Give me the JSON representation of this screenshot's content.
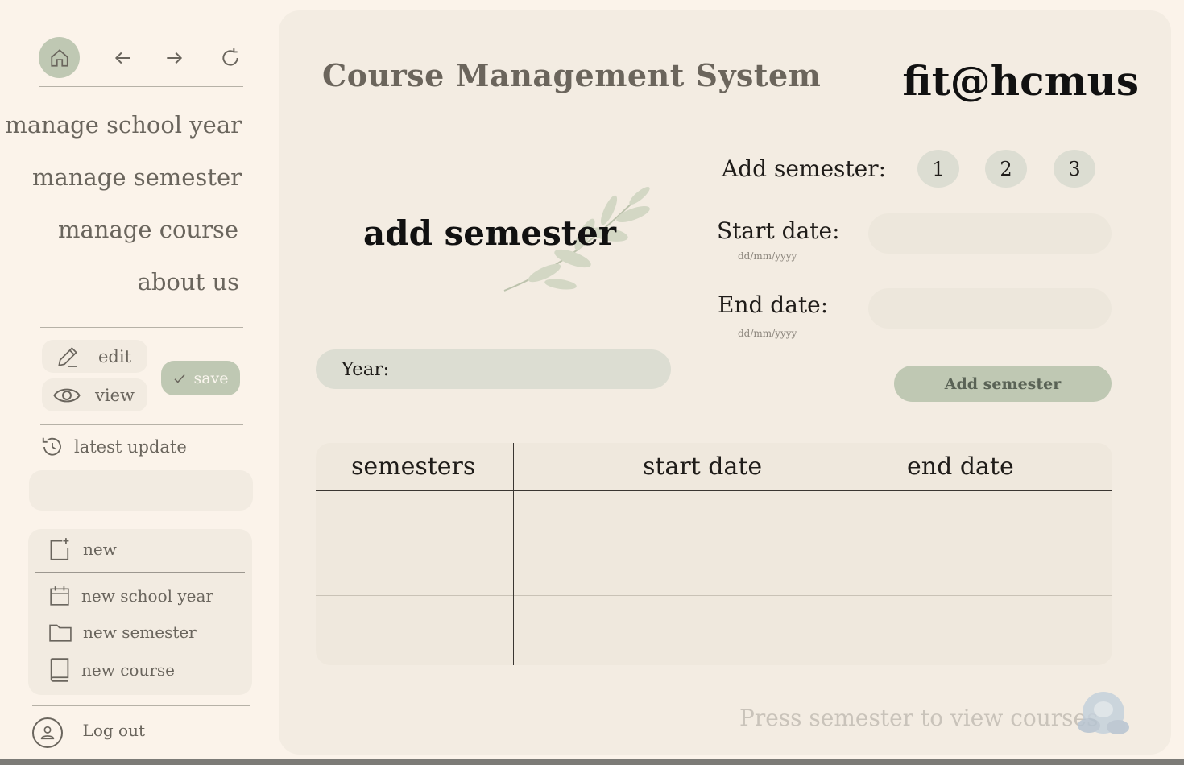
{
  "sidebar": {
    "menu": [
      {
        "label": "manage school year"
      },
      {
        "label": "manage semester"
      },
      {
        "label": "manage course"
      },
      {
        "label": "about us"
      }
    ],
    "edit_label": "edit",
    "view_label": "view",
    "save_label": "save",
    "latest_label": "latest update",
    "new_label": "new",
    "new_items": [
      {
        "label": "new school year",
        "icon": "calendar-icon"
      },
      {
        "label": "new semester",
        "icon": "folder-icon"
      },
      {
        "label": "new course",
        "icon": "book-icon"
      }
    ],
    "logout_label": "Log out"
  },
  "header": {
    "title": "Course Management System",
    "brand": "fit@hcmus"
  },
  "form": {
    "heading": "add semester",
    "add_semester_label": "Add semester:",
    "semester_numbers": [
      "1",
      "2",
      "3"
    ],
    "start_label": "Start date:",
    "start_hint": "dd/mm/yyyy",
    "start_value": "",
    "end_label": "End date:",
    "end_hint": "dd/mm/yyyy",
    "end_value": "",
    "year_label": "Year:",
    "submit_label": "Add semester"
  },
  "table": {
    "columns": [
      "semesters",
      "start date",
      "end date"
    ],
    "rows": [
      [
        "",
        "",
        ""
      ],
      [
        "",
        "",
        ""
      ],
      [
        "",
        "",
        ""
      ]
    ]
  },
  "footer_hint": "Press semester to view courses",
  "colors": {
    "background": "#fbf3ea",
    "panel": "#f3ece2",
    "accent": "#bfc8b3",
    "field": "#dcddd2"
  }
}
